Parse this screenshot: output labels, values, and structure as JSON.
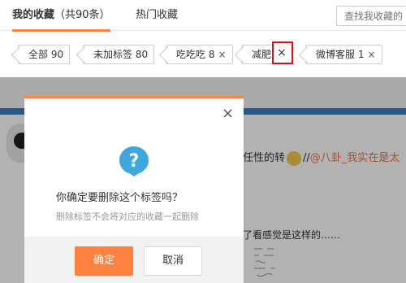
{
  "tabs": {
    "active": {
      "label": "我的收藏",
      "count": "（共90条）"
    },
    "hot": {
      "label": "热门收藏"
    },
    "search_placeholder": "查找我收藏的"
  },
  "tags": [
    {
      "label": "全部 90",
      "close": ""
    },
    {
      "label": "未加标签 80",
      "close": ""
    },
    {
      "label": "吃吃吃 8",
      "close": "×"
    },
    {
      "label": "减肥",
      "close": ""
    },
    {
      "label": "微博客服 1",
      "close": "×"
    }
  ],
  "highlighted_delete": "×",
  "post": {
    "text_before": "任性的转",
    "text_after": "//",
    "mention": "@八卦_我实在是太",
    "line2": "了看感觉是这样的……"
  },
  "dialog": {
    "close": "×",
    "question": "你确定要删除这个标签吗？",
    "hint": "删除标签不会将对应的收藏一起删除",
    "confirm_label": "确定",
    "cancel_label": "取消",
    "icon_glyph": "?"
  },
  "colors": {
    "accent": "#ff8140",
    "icon_blue": "#3fa7dc",
    "highlight_red": "#e01010",
    "link": "#eb7350"
  }
}
